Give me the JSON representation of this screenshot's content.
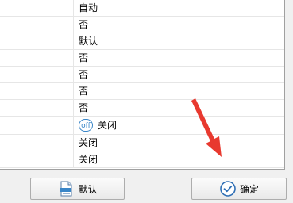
{
  "table": {
    "rows": [
      {
        "value": "自动"
      },
      {
        "value": "否"
      },
      {
        "value": "默认"
      },
      {
        "value": "否"
      },
      {
        "value": "否"
      },
      {
        "value": "否"
      },
      {
        "value": "否"
      },
      {
        "value": "关闭",
        "icon": "off-toggle-icon",
        "icon_text": "off"
      },
      {
        "value": "关闭"
      },
      {
        "value": "关闭"
      }
    ]
  },
  "buttons": {
    "default_label": "默认",
    "ok_label": "确定"
  },
  "colors": {
    "arrow": "#e8392f",
    "icon_blue": "#3a86c8"
  }
}
